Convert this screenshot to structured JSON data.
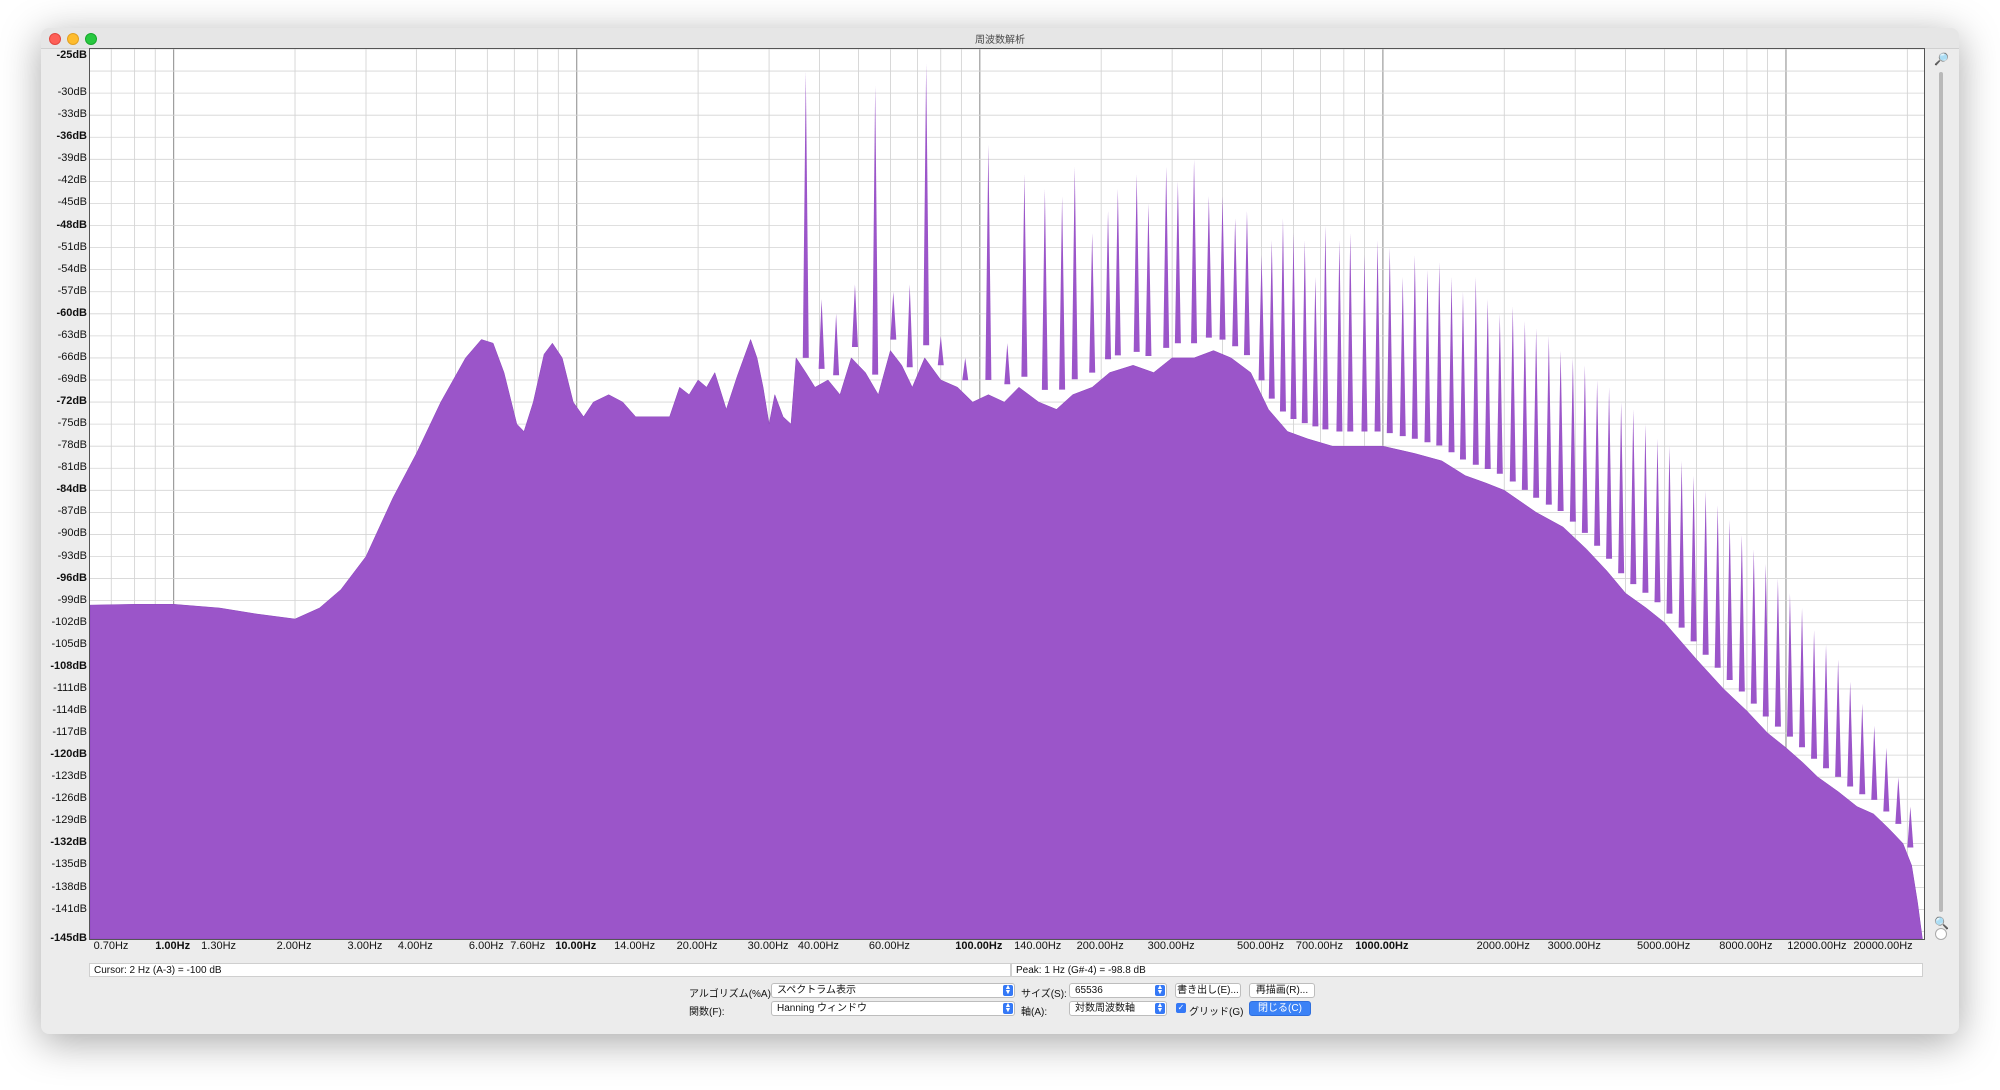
{
  "window": {
    "title": "周波数解析"
  },
  "y_axis_labels": [
    {
      "text": "-25dB",
      "bold": true
    },
    {
      "text": "-30dB",
      "bold": false
    },
    {
      "text": "-33dB",
      "bold": false
    },
    {
      "text": "-36dB",
      "bold": true
    },
    {
      "text": "-39dB",
      "bold": false
    },
    {
      "text": "-42dB",
      "bold": false
    },
    {
      "text": "-45dB",
      "bold": false
    },
    {
      "text": "-48dB",
      "bold": true
    },
    {
      "text": "-51dB",
      "bold": false
    },
    {
      "text": "-54dB",
      "bold": false
    },
    {
      "text": "-57dB",
      "bold": false
    },
    {
      "text": "-60dB",
      "bold": true
    },
    {
      "text": "-63dB",
      "bold": false
    },
    {
      "text": "-66dB",
      "bold": false
    },
    {
      "text": "-69dB",
      "bold": false
    },
    {
      "text": "-72dB",
      "bold": true
    },
    {
      "text": "-75dB",
      "bold": false
    },
    {
      "text": "-78dB",
      "bold": false
    },
    {
      "text": "-81dB",
      "bold": false
    },
    {
      "text": "-84dB",
      "bold": true
    },
    {
      "text": "-87dB",
      "bold": false
    },
    {
      "text": "-90dB",
      "bold": false
    },
    {
      "text": "-93dB",
      "bold": false
    },
    {
      "text": "-96dB",
      "bold": true
    },
    {
      "text": "-99dB",
      "bold": false
    },
    {
      "text": "-102dB",
      "bold": false
    },
    {
      "text": "-105dB",
      "bold": false
    },
    {
      "text": "-108dB",
      "bold": true
    },
    {
      "text": "-111dB",
      "bold": false
    },
    {
      "text": "-114dB",
      "bold": false
    },
    {
      "text": "-117dB",
      "bold": false
    },
    {
      "text": "-120dB",
      "bold": true
    },
    {
      "text": "-123dB",
      "bold": false
    },
    {
      "text": "-126dB",
      "bold": false
    },
    {
      "text": "-129dB",
      "bold": false
    },
    {
      "text": "-132dB",
      "bold": true
    },
    {
      "text": "-135dB",
      "bold": false
    },
    {
      "text": "-138dB",
      "bold": false
    },
    {
      "text": "-141dB",
      "bold": false
    },
    {
      "text": "-145dB",
      "bold": true
    }
  ],
  "x_axis_labels": [
    {
      "text": "0.70Hz",
      "bold": false,
      "hz": 0.7
    },
    {
      "text": "1.00Hz",
      "bold": true,
      "hz": 1.0
    },
    {
      "text": "1.30Hz",
      "bold": false,
      "hz": 1.3
    },
    {
      "text": "2.00Hz",
      "bold": false,
      "hz": 2.0
    },
    {
      "text": "3.00Hz",
      "bold": false,
      "hz": 3.0
    },
    {
      "text": "4.00Hz",
      "bold": false,
      "hz": 4.0
    },
    {
      "text": "6.00Hz",
      "bold": false,
      "hz": 6.0
    },
    {
      "text": "7.60Hz",
      "bold": false,
      "hz": 7.6
    },
    {
      "text": "10.00Hz",
      "bold": true,
      "hz": 10.0
    },
    {
      "text": "14.00Hz",
      "bold": false,
      "hz": 14.0
    },
    {
      "text": "20.00Hz",
      "bold": false,
      "hz": 20.0
    },
    {
      "text": "30.00Hz",
      "bold": false,
      "hz": 30.0
    },
    {
      "text": "40.00Hz",
      "bold": false,
      "hz": 40.0
    },
    {
      "text": "60.00Hz",
      "bold": false,
      "hz": 60.0
    },
    {
      "text": "100.00Hz",
      "bold": true,
      "hz": 100.0
    },
    {
      "text": "140.00Hz",
      "bold": false,
      "hz": 140.0
    },
    {
      "text": "200.00Hz",
      "bold": false,
      "hz": 200.0
    },
    {
      "text": "300.00Hz",
      "bold": false,
      "hz": 300.0
    },
    {
      "text": "500.00Hz",
      "bold": false,
      "hz": 500.0
    },
    {
      "text": "700.00Hz",
      "bold": false,
      "hz": 700.0
    },
    {
      "text": "1000.00Hz",
      "bold": true,
      "hz": 1000.0
    },
    {
      "text": "2000.00Hz",
      "bold": false,
      "hz": 2000.0
    },
    {
      "text": "3000.00Hz",
      "bold": false,
      "hz": 3000.0
    },
    {
      "text": "5000.00Hz",
      "bold": false,
      "hz": 5000.0
    },
    {
      "text": "8000.00Hz",
      "bold": false,
      "hz": 8000.0
    },
    {
      "text": "12000.00Hz",
      "bold": false,
      "hz": 12000.0
    },
    {
      "text": "20000.00Hz",
      "bold": false,
      "hz": 20000.0
    }
  ],
  "chart_data": {
    "type": "area",
    "x_scale": "log",
    "xlim": [
      0.62,
      22000
    ],
    "ylim": [
      -145,
      -24
    ],
    "grid": true,
    "color": "#9b55c9",
    "baseline_curve": [
      [
        0.62,
        -99.6
      ],
      [
        0.8,
        -99.5
      ],
      [
        1.0,
        -99.5
      ],
      [
        1.3,
        -100
      ],
      [
        1.6,
        -100.8
      ],
      [
        2.0,
        -101.5
      ],
      [
        2.3,
        -100
      ],
      [
        2.6,
        -97.5
      ],
      [
        3.0,
        -93
      ],
      [
        3.5,
        -85
      ],
      [
        4.0,
        -79
      ],
      [
        4.6,
        -72
      ],
      [
        5.3,
        -66
      ],
      [
        5.8,
        -63.5
      ],
      [
        6.2,
        -64
      ],
      [
        6.6,
        -68
      ],
      [
        7.1,
        -75
      ],
      [
        7.4,
        -76
      ],
      [
        7.8,
        -72
      ],
      [
        8.3,
        -65.5
      ],
      [
        8.7,
        -64
      ],
      [
        9.2,
        -66
      ],
      [
        9.8,
        -72
      ],
      [
        10.4,
        -74
      ],
      [
        11,
        -72
      ],
      [
        12,
        -71
      ],
      [
        13,
        -72
      ],
      [
        14,
        -74
      ],
      [
        15.5,
        -74
      ],
      [
        17,
        -74
      ],
      [
        18,
        -70
      ],
      [
        19,
        -71
      ],
      [
        20,
        -69
      ],
      [
        21,
        -70
      ],
      [
        22,
        -68
      ],
      [
        23.5,
        -73
      ],
      [
        25,
        -68.5
      ],
      [
        27,
        -63.5
      ],
      [
        28,
        -66
      ],
      [
        29,
        -70
      ],
      [
        30,
        -75
      ],
      [
        31,
        -71
      ],
      [
        32.5,
        -74
      ],
      [
        34,
        -75
      ],
      [
        35,
        -66
      ],
      [
        37,
        -68
      ],
      [
        39,
        -70
      ],
      [
        42,
        -69
      ],
      [
        45,
        -71
      ],
      [
        48,
        -66
      ],
      [
        52,
        -68
      ],
      [
        56,
        -71
      ],
      [
        60,
        -65
      ],
      [
        64,
        -67
      ],
      [
        68,
        -70
      ],
      [
        73,
        -66
      ],
      [
        80,
        -69
      ],
      [
        88,
        -70
      ],
      [
        96,
        -72
      ],
      [
        105,
        -71
      ],
      [
        115,
        -72
      ],
      [
        125,
        -70
      ],
      [
        140,
        -72
      ],
      [
        155,
        -73
      ],
      [
        170,
        -71
      ],
      [
        190,
        -70
      ],
      [
        210,
        -68
      ],
      [
        240,
        -67
      ],
      [
        270,
        -68
      ],
      [
        300,
        -66
      ],
      [
        340,
        -66
      ],
      [
        380,
        -65
      ],
      [
        420,
        -66
      ],
      [
        470,
        -68
      ],
      [
        520,
        -73
      ],
      [
        580,
        -76
      ],
      [
        650,
        -77
      ],
      [
        750,
        -78
      ],
      [
        900,
        -78
      ],
      [
        1000,
        -78
      ],
      [
        1200,
        -79
      ],
      [
        1400,
        -80
      ],
      [
        1600,
        -82
      ],
      [
        1800,
        -83
      ],
      [
        2000,
        -84
      ],
      [
        2400,
        -87
      ],
      [
        2800,
        -89
      ],
      [
        3200,
        -92
      ],
      [
        3600,
        -95
      ],
      [
        4000,
        -98
      ],
      [
        4500,
        -100
      ],
      [
        5000,
        -102
      ],
      [
        6000,
        -107
      ],
      [
        7000,
        -111
      ],
      [
        8000,
        -114
      ],
      [
        9000,
        -117
      ],
      [
        10000,
        -119
      ],
      [
        11000,
        -121
      ],
      [
        12000,
        -123
      ],
      [
        13500,
        -125
      ],
      [
        15000,
        -127
      ],
      [
        16500,
        -128
      ],
      [
        18000,
        -130
      ],
      [
        19500,
        -132
      ],
      [
        20500,
        -135
      ],
      [
        21200,
        -140
      ],
      [
        21800,
        -145
      ]
    ],
    "peaks": [
      [
        37.0,
        -27
      ],
      [
        40.5,
        -58
      ],
      [
        44.0,
        -60
      ],
      [
        49.0,
        -56
      ],
      [
        55.0,
        -29
      ],
      [
        61.0,
        -57
      ],
      [
        67.0,
        -56
      ],
      [
        73.6,
        -26
      ],
      [
        80.0,
        -63
      ],
      [
        92.0,
        -66
      ],
      [
        105.0,
        -37
      ],
      [
        117.0,
        -64
      ],
      [
        129.0,
        -41
      ],
      [
        145.0,
        -43
      ],
      [
        160.0,
        -44
      ],
      [
        172.0,
        -40
      ],
      [
        190.0,
        -49
      ],
      [
        208.0,
        -46
      ],
      [
        220.0,
        -43
      ],
      [
        245.0,
        -41
      ],
      [
        262.0,
        -45
      ],
      [
        290.0,
        -40
      ],
      [
        310.0,
        -42
      ],
      [
        340.0,
        -39
      ],
      [
        370.0,
        -44
      ],
      [
        400.0,
        -44
      ],
      [
        430.0,
        -47
      ],
      [
        460.0,
        -46
      ],
      [
        500.0,
        -52
      ],
      [
        530.0,
        -50
      ],
      [
        565.0,
        -47
      ],
      [
        600.0,
        -49
      ],
      [
        640.0,
        -50
      ],
      [
        680.0,
        -55
      ],
      [
        720.0,
        -48
      ],
      [
        780.0,
        -50
      ],
      [
        830.0,
        -49
      ],
      [
        900.0,
        -52
      ],
      [
        970.0,
        -50
      ],
      [
        1040.0,
        -51
      ],
      [
        1120.0,
        -55
      ],
      [
        1200.0,
        -52
      ],
      [
        1290.0,
        -54
      ],
      [
        1380.0,
        -53
      ],
      [
        1480.0,
        -55
      ],
      [
        1580.0,
        -57
      ],
      [
        1700.0,
        -55
      ],
      [
        1820.0,
        -58
      ],
      [
        1950.0,
        -60
      ],
      [
        2100.0,
        -59
      ],
      [
        2250.0,
        -61
      ],
      [
        2400.0,
        -62
      ],
      [
        2580.0,
        -63
      ],
      [
        2760.0,
        -65
      ],
      [
        2960.0,
        -66
      ],
      [
        3170.0,
        -67
      ],
      [
        3400.0,
        -69
      ],
      [
        3640.0,
        -70
      ],
      [
        3900.0,
        -72
      ],
      [
        4180.0,
        -73
      ],
      [
        4480.0,
        -75
      ],
      [
        4800.0,
        -77
      ],
      [
        5140.0,
        -78
      ],
      [
        5510.0,
        -80
      ],
      [
        5900.0,
        -82
      ],
      [
        6320.0,
        -84
      ],
      [
        6770.0,
        -86
      ],
      [
        7250.0,
        -88
      ],
      [
        7770.0,
        -90
      ],
      [
        8320.0,
        -92
      ],
      [
        8910.0,
        -94
      ],
      [
        9550.0,
        -96
      ],
      [
        10230.0,
        -98
      ],
      [
        10960.0,
        -100
      ],
      [
        11740.0,
        -103
      ],
      [
        12570.0,
        -105
      ],
      [
        13470.0,
        -107
      ],
      [
        14430.0,
        -110
      ],
      [
        15460.0,
        -113
      ],
      [
        16560.0,
        -116
      ],
      [
        17740.0,
        -119
      ],
      [
        19000.0,
        -123
      ],
      [
        20350.0,
        -127
      ]
    ]
  },
  "status": {
    "cursor": "Cursor:  2 Hz (A-3) = -100 dB",
    "peak": "Peak:  1 Hz (G#-4) = -98.8 dB"
  },
  "controls": {
    "algorithm_label": "アルゴリズム(%A):",
    "algorithm_value": "スペクトラム表示",
    "function_label": "関数(F):",
    "function_value": "Hanning ウィンドウ",
    "size_label": "サイズ(S):",
    "size_value": "65536",
    "axis_label": "軸(A):",
    "axis_value": "対数周波数軸",
    "export_button": "書き出し(E)...",
    "replot_button": "再描画(R)...",
    "grid_label": "グリッド(G)",
    "grid_checked": true,
    "close_button": "閉じる(C)"
  }
}
